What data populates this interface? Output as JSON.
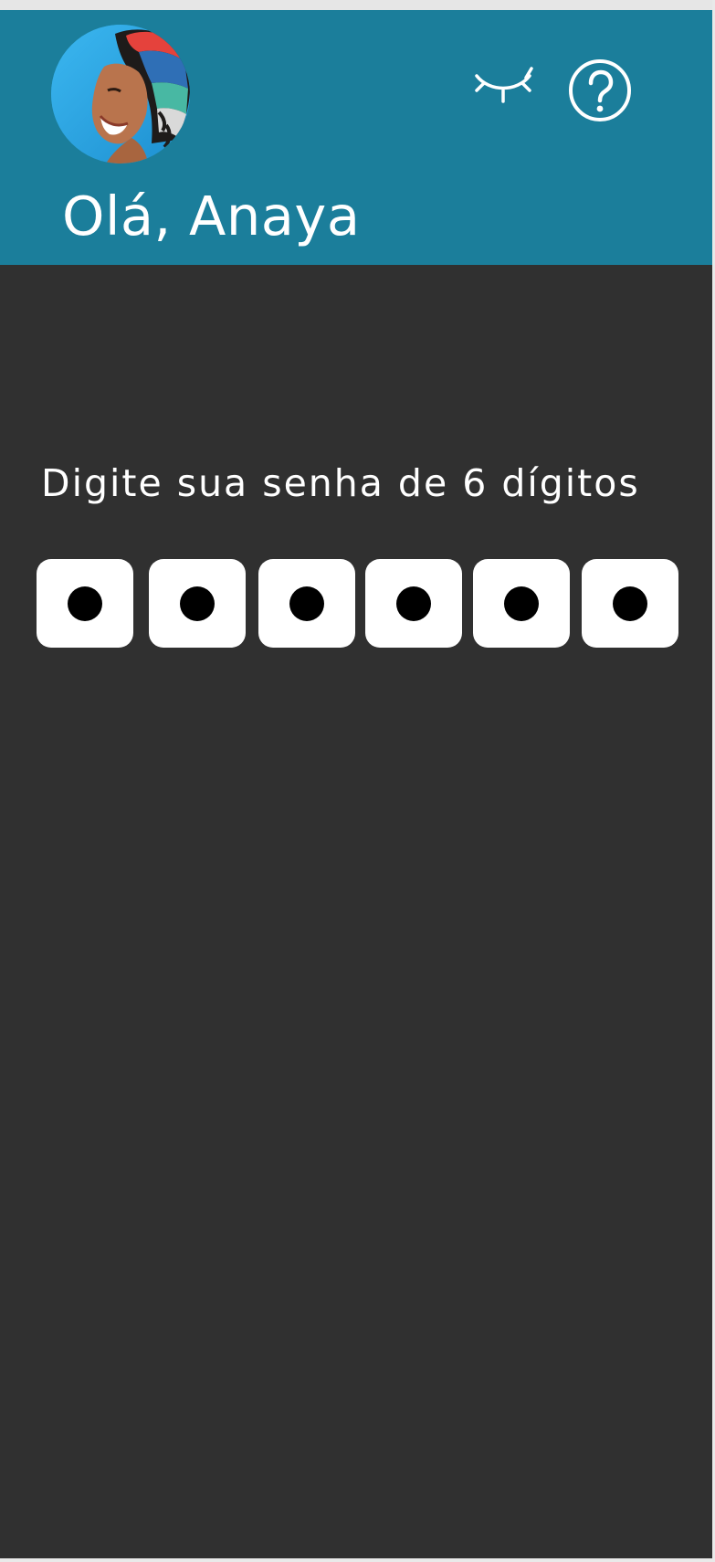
{
  "header": {
    "greeting": "Olá, Anaya",
    "avatar_icon": "user-avatar-photo",
    "visibility_icon": "closed-eye-icon",
    "help_icon": "question-circle-icon",
    "background_color": "#1b7e9b"
  },
  "pin": {
    "prompt": "Digite sua senha de 6 dígitos",
    "length": 6,
    "filled": 6,
    "box_color": "#ffffff",
    "dot_color": "#000000"
  },
  "colors": {
    "background": "#303030",
    "text": "#ffffff"
  }
}
